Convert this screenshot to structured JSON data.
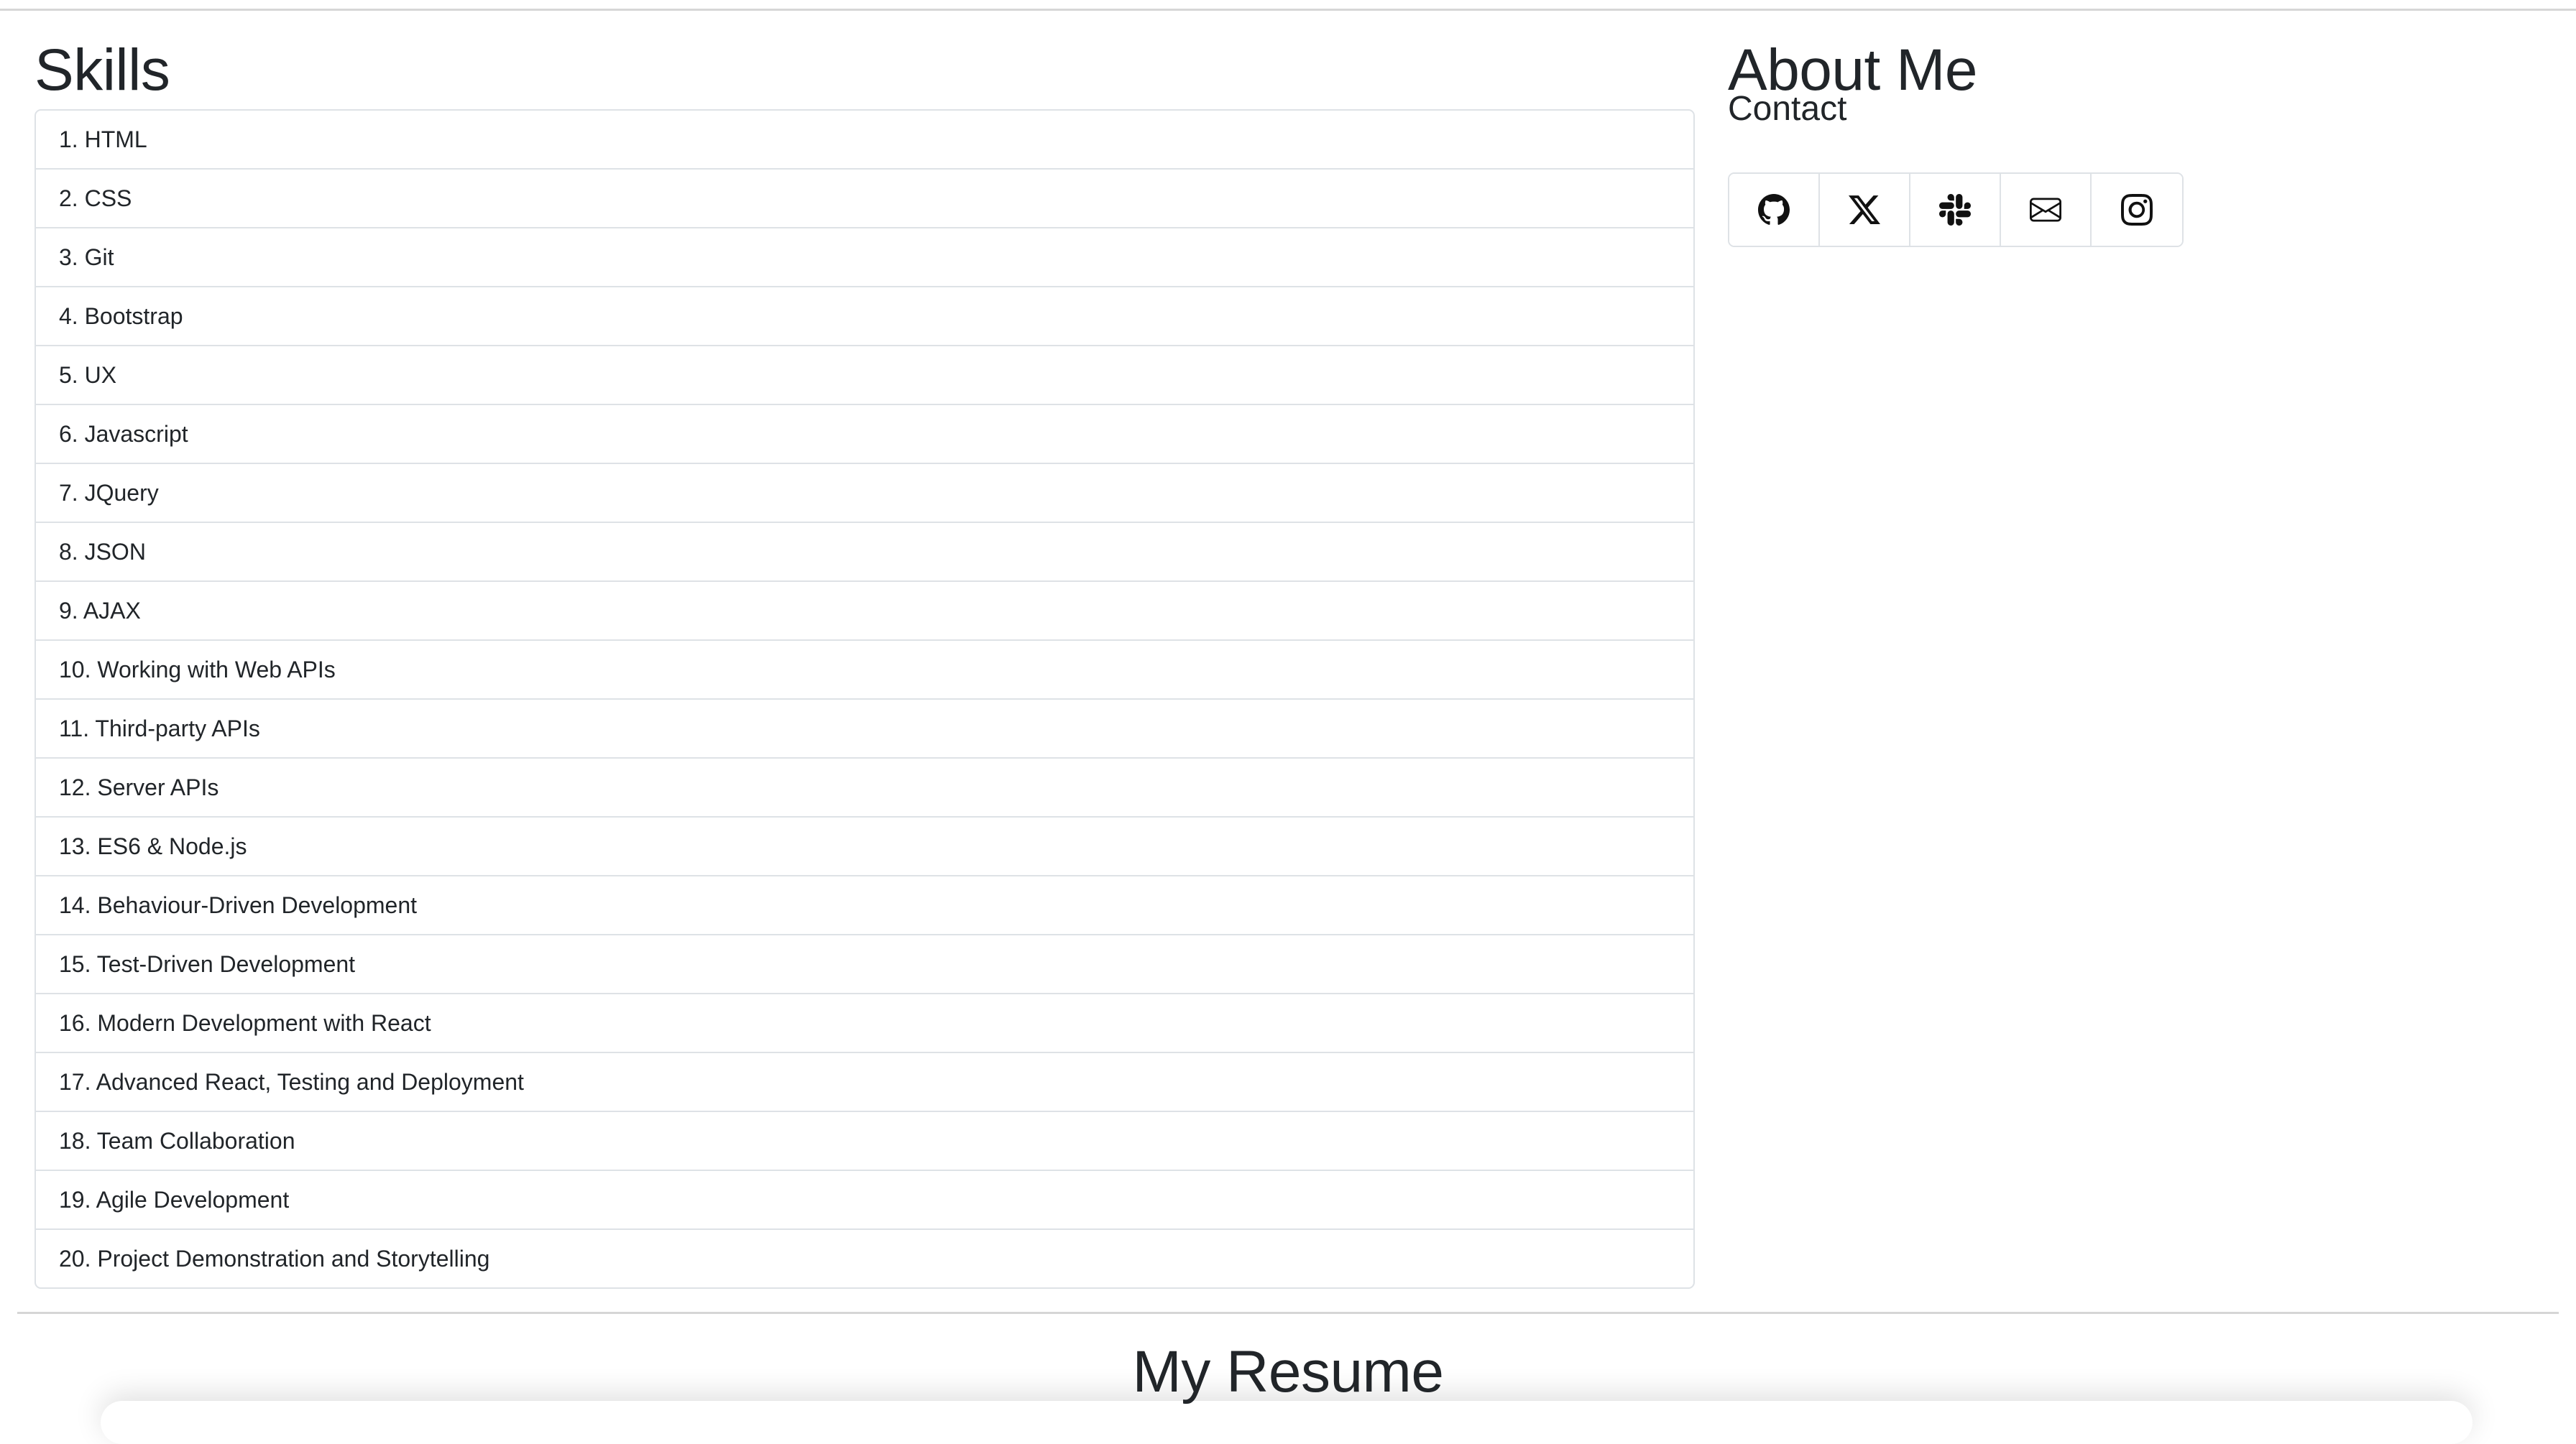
{
  "skills": {
    "heading": "Skills",
    "items": [
      "1. HTML",
      "2. CSS",
      "3. Git",
      "4. Bootstrap",
      "5. UX",
      "6. Javascript",
      "7. JQuery",
      "8. JSON",
      "9. AJAX",
      "10. Working with Web APIs",
      "11. Third-party APIs",
      "12. Server APIs",
      "13. ES6 & Node.js",
      "14. Behaviour-Driven Development",
      "15. Test-Driven Development",
      "16. Modern Development with React",
      "17. Advanced React, Testing and Deployment",
      "18. Team Collaboration",
      "19. Agile Development",
      "20. Project Demonstration and Storytelling"
    ]
  },
  "about": {
    "heading": "About Me",
    "contact_heading": "Contact",
    "contact_icons": [
      "github-icon",
      "x-twitter-icon",
      "slack-icon",
      "envelope-icon",
      "instagram-icon"
    ]
  },
  "resume": {
    "heading": "My Resume"
  }
}
